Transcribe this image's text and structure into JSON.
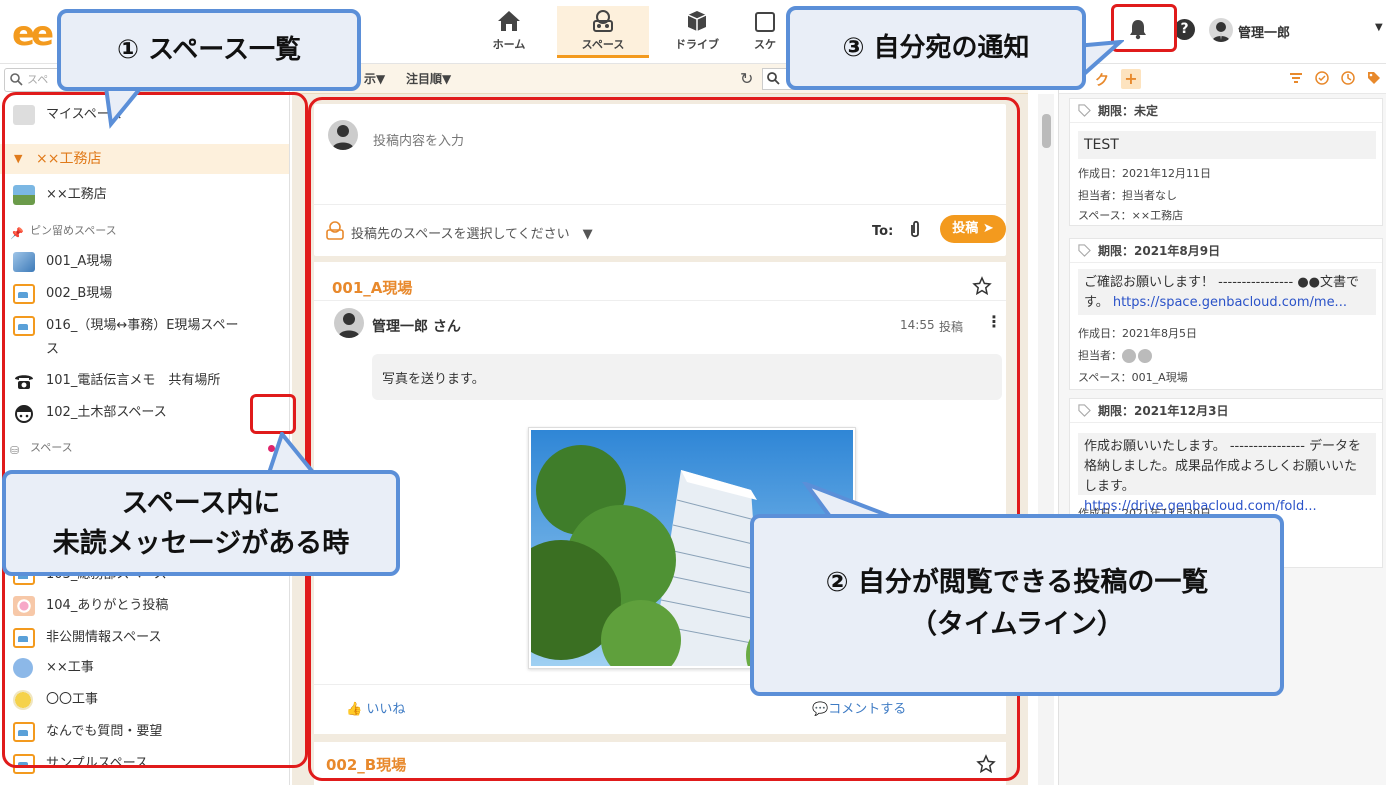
{
  "topbar": {
    "logo_text": "ee",
    "nav": [
      {
        "label": "ホーム",
        "icon": "home-icon"
      },
      {
        "label": "スペース",
        "icon": "space-icon",
        "active": true
      },
      {
        "label": "ドライブ",
        "icon": "drive-icon"
      },
      {
        "label": "スケ",
        "icon": "schedule-icon"
      }
    ],
    "help": "?",
    "user_name": "管理一郎"
  },
  "sidebar": {
    "search_placeholder": "スペ",
    "my_space": "マイスペース",
    "group_name": "××工務店",
    "company_space": "××工務店",
    "pinned_header": "ピン留めスペース",
    "pinned": [
      {
        "label": "001_A現場"
      },
      {
        "label": "002_B現場"
      },
      {
        "label": "016_（現場↔事務）E現場スペー",
        "label2": "ス"
      },
      {
        "label": "101_電話伝言メモ　共有場所",
        "unread": true
      },
      {
        "label": "102_土木部スペース",
        "unread": true
      }
    ],
    "spaces_header": "スペース",
    "spaces": [
      {
        "label": "103_総務部スペース"
      },
      {
        "label": "104_ありがとう投稿"
      },
      {
        "label": "非公開情報スペース"
      },
      {
        "label": "××工事"
      },
      {
        "label": "〇〇工事"
      },
      {
        "label": "なんでも質問・要望"
      },
      {
        "label": "サンプルスペース"
      }
    ]
  },
  "filter": {
    "display": "示",
    "sort": "注目順"
  },
  "composer": {
    "placeholder": "投稿内容を入力",
    "space_select": "投稿先のスペースを選択してください",
    "to_label": "To:",
    "post_button": "投稿"
  },
  "posts": [
    {
      "space": "001_A現場",
      "author": "管理一郎 さん",
      "time": "14:55",
      "type": "投稿",
      "message": "写真を送ります。",
      "like": "いいね",
      "comment": "コメントする"
    },
    {
      "space": "002_B現場"
    }
  ],
  "rpanel": {
    "tab_label": "ク",
    "plus": "+",
    "tasks": [
      {
        "deadline": "期限：未定",
        "body": "TEST",
        "created": "作成日：2021年12月11日",
        "assignee": "担当者：担当者なし",
        "space": "スペース：××工務店"
      },
      {
        "deadline": "期限：2021年8月9日",
        "body_line1": "ご確認お願いします！ ---------------- ●●文書で",
        "body_line2": "す。",
        "link": "https://space.genbacloud.com/me...",
        "created": "作成日：2021年8月5日",
        "assignee": "担当者：",
        "space": "スペース：001_A現場"
      },
      {
        "deadline": "期限：2021年12月3日",
        "body_line1": "作成お願いいたします。 ---------------- データを",
        "body_line2": "格納しました。成果品作成よろしくお願いいた",
        "body_line3": "します。",
        "link": "https://drive.genbacloud.com/fold...",
        "created": "作成日：2021年11月30日"
      }
    ]
  },
  "callouts": {
    "c1": "① スペース一覧",
    "c2_line1": "② 自分が閲覧できる投稿の一覧",
    "c2_line2": "（タイムライン）",
    "c3": "③ 自分宛の通知",
    "c4_line1": "スペース内に",
    "c4_line2": "未読メッセージがある時"
  },
  "colors": {
    "accent": "#f39a1e",
    "callout_border": "#5b8fd8",
    "callout_fill": "#e9eef7",
    "highlight": "#e01b1b",
    "unread_dot": "#e0246a"
  }
}
